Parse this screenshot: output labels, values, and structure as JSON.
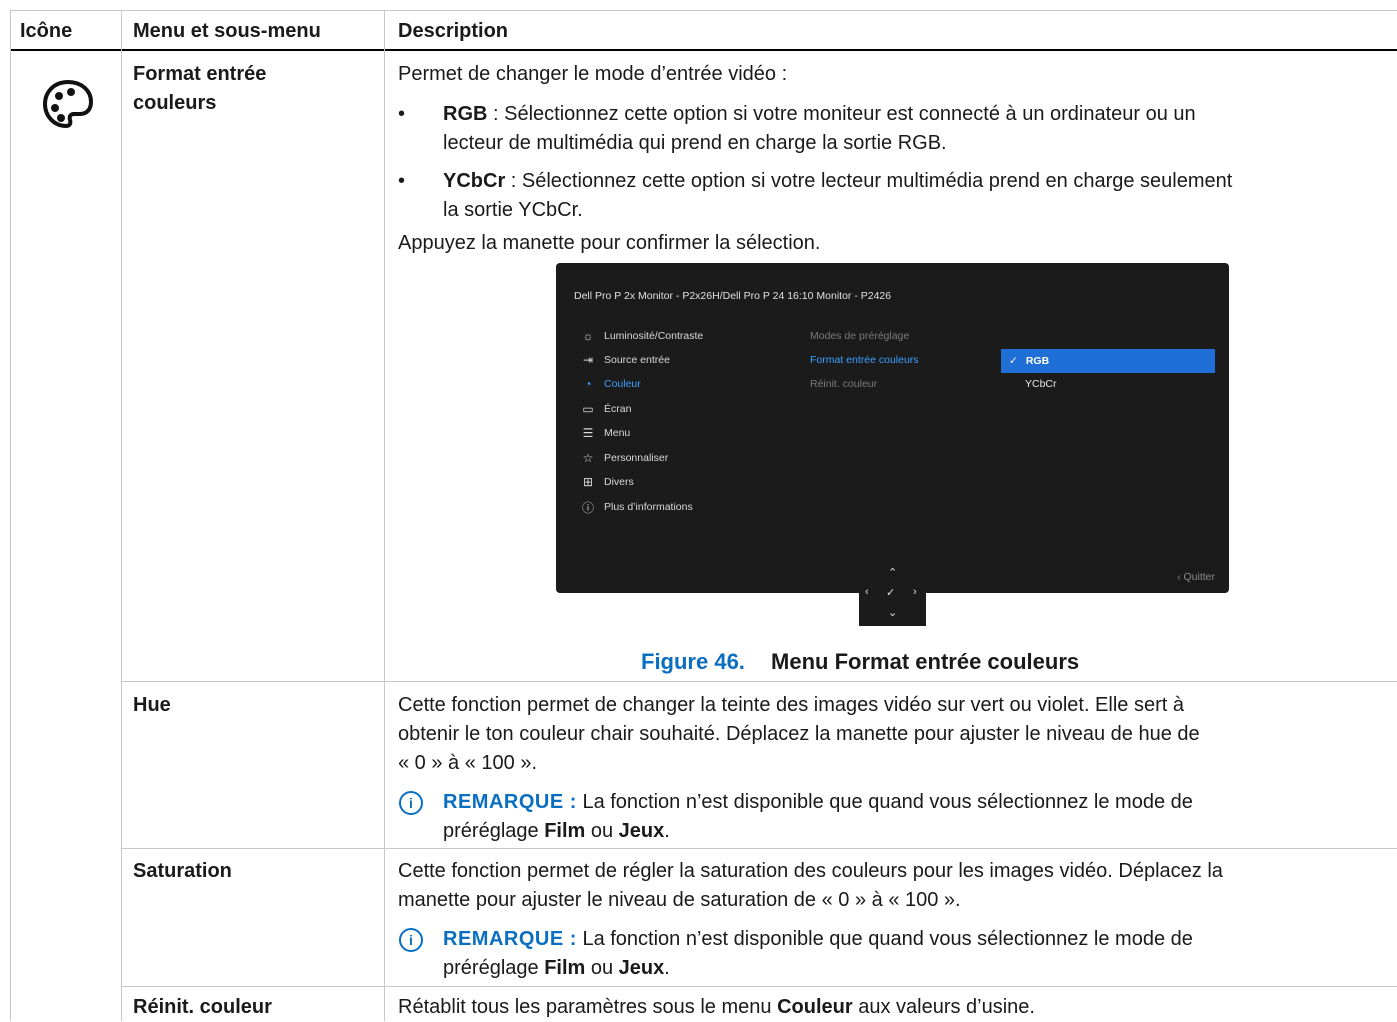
{
  "table": {
    "headers": {
      "icon": "Icône",
      "menu": "Menu et sous-menu",
      "description": "Description"
    },
    "rows": [
      {
        "menu": "Format entrée\ncouleurs",
        "intro": "Permet de changer le mode d’entrée vidéo :",
        "bullets": [
          {
            "term": "RGB",
            "text": " : Sélectionnez cette option si votre moniteur est connecté à un ordinateur ou un",
            "text2": "lecteur de multimédia qui prend en charge la sortie RGB."
          },
          {
            "term": "YCbCr",
            "text": " : Sélectionnez cette option si votre lecteur multimédia prend en charge seulement",
            "text2": "la sortie YCbCr."
          }
        ],
        "outro": "Appuyez la manette pour confirmer la sélection.",
        "figure": {
          "number": "Figure 46.",
          "title": "Menu Format entrée couleurs"
        }
      },
      {
        "menu": "Hue",
        "lines": [
          "Cette fonction permet de changer la teinte des images vidéo sur vert ou violet. Elle sert à",
          "obtenir le ton couleur chair souhaité. Déplacez la manette pour ajuster le niveau de hue de",
          "« 0 » à « 100 »."
        ],
        "note": {
          "label": "REMARQUE :",
          "text1": " La fonction n’est disponible que quand vous sélectionnez le mode de",
          "pre": "préréglage ",
          "b1": "Film",
          "mid": " ou ",
          "b2": "Jeux",
          "end": "."
        }
      },
      {
        "menu": "Saturation",
        "lines": [
          "Cette fonction permet de régler la saturation des couleurs pour les images vidéo. Déplacez la",
          "manette pour ajuster le niveau de saturation de « 0 » à « 100 »."
        ],
        "note": {
          "label": "REMARQUE :",
          "text1": " La fonction n’est disponible que quand vous sélectionnez le mode de",
          "pre": "préréglage ",
          "b1": "Film",
          "mid": " ou ",
          "b2": "Jeux",
          "end": "."
        }
      },
      {
        "menu": "Réinit. couleur",
        "pre": "Rétablit tous les paramètres sous le menu ",
        "bold": "Couleur",
        "post": " aux valeurs d’usine."
      }
    ]
  },
  "osd": {
    "title": "Dell Pro P 2x Monitor - P2x26H/Dell Pro P 24 16:10 Monitor - P2426",
    "menu": [
      {
        "label": "Luminosité/Contraste",
        "icon": "brightness-icon"
      },
      {
        "label": "Source entrée",
        "icon": "input-source-icon"
      },
      {
        "label": "Couleur",
        "icon": "palette-icon",
        "active": true
      },
      {
        "label": "Écran",
        "icon": "display-icon"
      },
      {
        "label": "Menu",
        "icon": "menu-list-icon"
      },
      {
        "label": "Personnaliser",
        "icon": "star-icon"
      },
      {
        "label": "Divers",
        "icon": "others-icon"
      },
      {
        "label": "Plus d’informations",
        "icon": "info-icon"
      }
    ],
    "submenu": [
      "Modes de préréglage",
      "Format entrée couleurs",
      "Réinit. couleur"
    ],
    "options": {
      "selected": "RGB",
      "other": "YCbCr"
    },
    "quit": "Quitter"
  },
  "colors": {
    "accent": "#0a6fc0",
    "osd_bg": "#1b1b1b",
    "osd_highlight": "#1f6fd6"
  }
}
